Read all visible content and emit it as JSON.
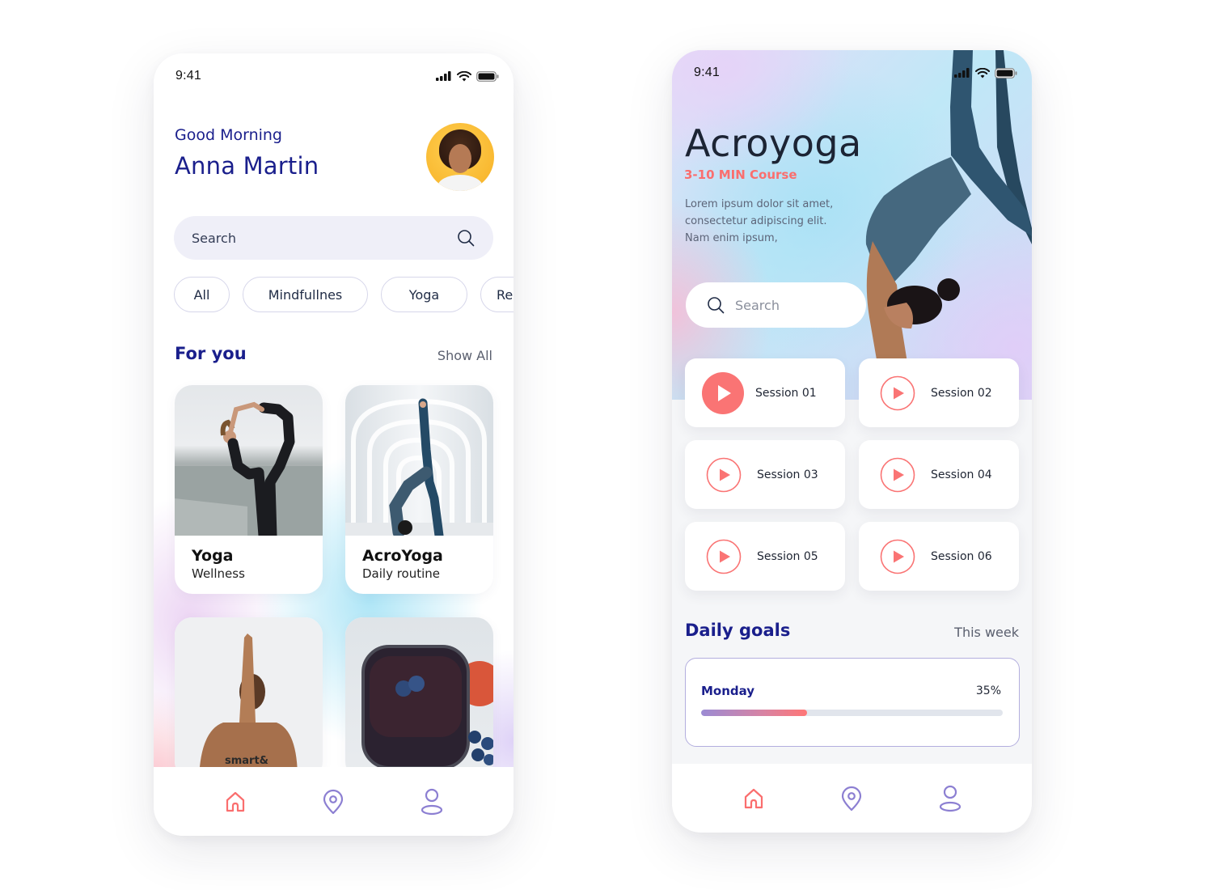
{
  "colors": {
    "brand_navy": "#1a1f8c",
    "accent_coral": "#fa6e6e",
    "accent_purple": "#8c7fd2",
    "text_dark": "#1f2533"
  },
  "home_screen": {
    "status_bar": {
      "time": "9:41",
      "icons": [
        "signal-icon",
        "wifi-icon",
        "battery-icon"
      ]
    },
    "header": {
      "greeting": "Good Morning",
      "user_name": "Anna Martin",
      "avatar": "user-avatar"
    },
    "search": {
      "placeholder": "Search",
      "icon": "search-icon"
    },
    "categories": [
      {
        "label": "All"
      },
      {
        "label": "Mindfullnes"
      },
      {
        "label": "Yoga"
      },
      {
        "label": "Rel"
      }
    ],
    "for_you": {
      "title": "For you",
      "show_all_label": "Show All",
      "cards": [
        {
          "title": "Yoga",
          "subtitle": "Wellness",
          "image": "dancer-pose-photo"
        },
        {
          "title": "AcroYoga",
          "subtitle": "Daily routine",
          "image": "wheel-pose-photo"
        },
        {
          "title": "",
          "subtitle": "",
          "image": "prayer-hands-photo"
        },
        {
          "title": "",
          "subtitle": "",
          "image": "berry-smoothie-photo"
        }
      ]
    },
    "bottom_nav": [
      {
        "name": "home",
        "icon": "home-icon",
        "active": true
      },
      {
        "name": "location",
        "icon": "location-pin-icon",
        "active": false
      },
      {
        "name": "profile",
        "icon": "user-icon",
        "active": false
      }
    ]
  },
  "course_screen": {
    "status_bar": {
      "time": "9:41",
      "icons": [
        "signal-icon",
        "wifi-icon",
        "battery-icon"
      ]
    },
    "course": {
      "title": "Acroyoga",
      "duration": "3-10 MIN Course",
      "description": "Lorem ipsum dolor sit amet, consectetur adipiscing elit. Nam enim ipsum,"
    },
    "search": {
      "placeholder": "Search",
      "icon": "search-icon"
    },
    "sessions": [
      {
        "label": "Session 01",
        "active": true
      },
      {
        "label": "Session 02",
        "active": false
      },
      {
        "label": "Session 03",
        "active": false
      },
      {
        "label": "Session 04",
        "active": false
      },
      {
        "label": "Session 05",
        "active": false
      },
      {
        "label": "Session 06",
        "active": false
      }
    ],
    "daily_goals": {
      "title": "Daily goals",
      "period_label": "This week",
      "items": [
        {
          "day": "Monday",
          "percent_label": "35%",
          "progress": 0.35
        }
      ]
    },
    "bottom_nav": [
      {
        "name": "home",
        "icon": "home-icon",
        "active": true
      },
      {
        "name": "location",
        "icon": "location-pin-icon",
        "active": false
      },
      {
        "name": "profile",
        "icon": "user-icon",
        "active": false
      }
    ]
  }
}
